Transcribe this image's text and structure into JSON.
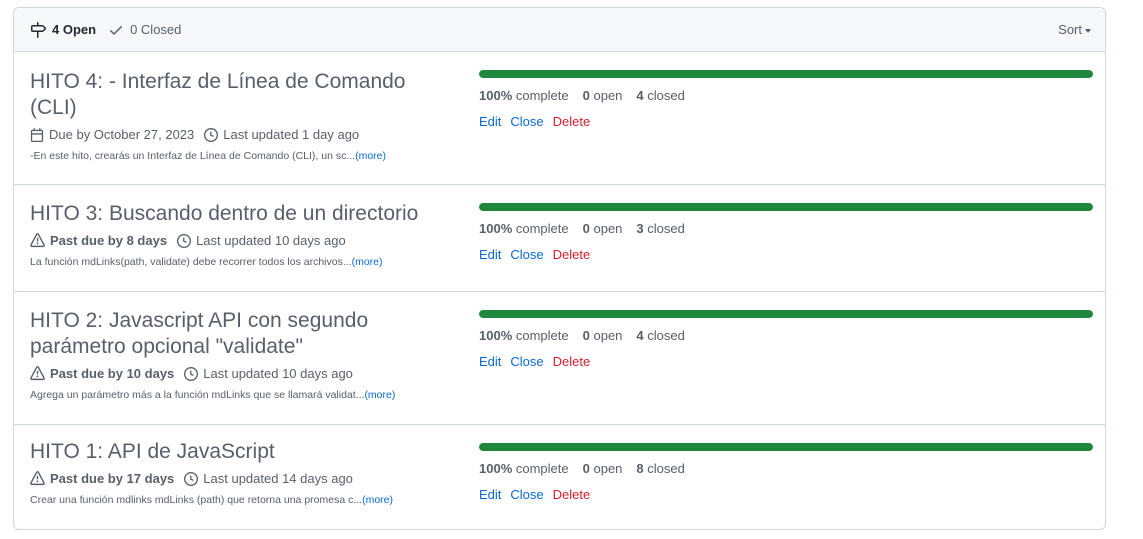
{
  "header": {
    "open_label": "4 Open",
    "closed_label": "0 Closed",
    "sort_label": "Sort"
  },
  "milestones": [
    {
      "title": "HITO 4: - Interfaz de Línea de Comando (CLI)",
      "due_icon": "calendar-icon",
      "due_text": "Due by October 27, 2023",
      "updated_text": "Last updated 1 day ago",
      "description": "-En este hito, crearás un Interfaz de Línea de Comando (CLI), un sc...",
      "more_label": "(more)",
      "progress": 1.0,
      "complete_pct": "100%",
      "complete_label": "complete",
      "open_count": "0",
      "open_label": "open",
      "closed_count": "4",
      "closed_label": "closed",
      "edit_label": "Edit",
      "close_label": "Close",
      "delete_label": "Delete"
    },
    {
      "title": "HITO 3: Buscando dentro de un directorio",
      "due_icon": "alert-icon",
      "due_text": "Past due by 8 days",
      "updated_text": "Last updated 10 days ago",
      "description": "La función mdLinks(path, validate) debe recorrer todos los archivos...",
      "more_label": "(more)",
      "progress": 1.0,
      "complete_pct": "100%",
      "complete_label": "complete",
      "open_count": "0",
      "open_label": "open",
      "closed_count": "3",
      "closed_label": "closed",
      "edit_label": "Edit",
      "close_label": "Close",
      "delete_label": "Delete"
    },
    {
      "title": "HITO 2: Javascript API con segundo parámetro opcional \"validate\"",
      "due_icon": "alert-icon",
      "due_text": "Past due by 10 days",
      "updated_text": "Last updated 10 days ago",
      "description": "Agrega un parámetro más a la función mdLinks que se llamará validat...",
      "more_label": "(more)",
      "progress": 1.0,
      "complete_pct": "100%",
      "complete_label": "complete",
      "open_count": "0",
      "open_label": "open",
      "closed_count": "4",
      "closed_label": "closed",
      "edit_label": "Edit",
      "close_label": "Close",
      "delete_label": "Delete"
    },
    {
      "title": "HITO 1: API de JavaScript",
      "due_icon": "alert-icon",
      "due_text": "Past due by 17 days",
      "updated_text": "Last updated 14 days ago",
      "description": "Crear una función mdlinks mdLinks (path) que retorna una promesa c...",
      "more_label": "(more)",
      "progress": 1.0,
      "complete_pct": "100%",
      "complete_label": "complete",
      "open_count": "0",
      "open_label": "open",
      "closed_count": "8",
      "closed_label": "closed",
      "edit_label": "Edit",
      "close_label": "Close",
      "delete_label": "Delete"
    }
  ],
  "colors": {
    "progress": "#1f883d",
    "link": "#0969da",
    "danger": "#cf222e"
  }
}
